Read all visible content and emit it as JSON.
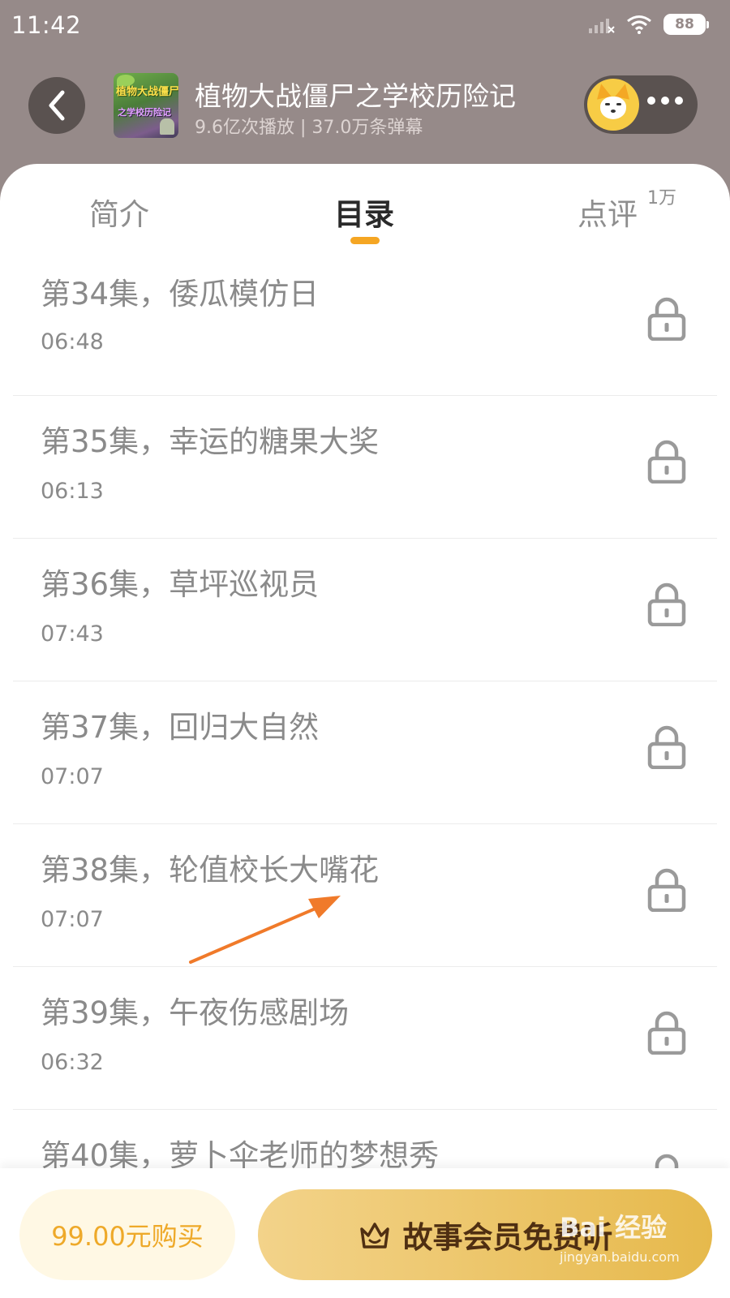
{
  "status_bar": {
    "time": "11:42",
    "battery": "88"
  },
  "header": {
    "title": "植物大战僵尸之学校历险记",
    "subtitle": "9.6亿次播放 | 37.0万条弹幕",
    "cover_text_line1": "植物大战僵尸",
    "cover_text_line2": "之学校历险记"
  },
  "tabs": {
    "intro": "简介",
    "catalog": "目录",
    "review": "点评",
    "review_badge": "1万",
    "active": "catalog"
  },
  "episodes": [
    {
      "title": "第34集，倭瓜模仿日",
      "duration": "06:48",
      "locked": true
    },
    {
      "title": "第35集，幸运的糖果大奖",
      "duration": "06:13",
      "locked": true
    },
    {
      "title": "第36集，草坪巡视员",
      "duration": "07:43",
      "locked": true
    },
    {
      "title": "第37集，回归大自然",
      "duration": "07:07",
      "locked": true
    },
    {
      "title": "第38集，轮值校长大嘴花",
      "duration": "07:07",
      "locked": true
    },
    {
      "title": "第39集，午夜伤感剧场",
      "duration": "06:32",
      "locked": true
    },
    {
      "title": "第40集，萝卜伞老师的梦想秀",
      "duration": "",
      "locked": true
    }
  ],
  "bottom_bar": {
    "buy_label": "99.00元购买",
    "vip_label": "故事会员免费听"
  },
  "watermark": {
    "main": "Bai 经验",
    "sub": "jingyan.baidu.com"
  },
  "colors": {
    "header_bg": "#968a89",
    "accent": "#f5a623",
    "buy_text": "#eea929",
    "vip_gradient_start": "#f3d38a",
    "vip_gradient_end": "#e6b94c",
    "annotation_arrow": "#f07a2a"
  }
}
